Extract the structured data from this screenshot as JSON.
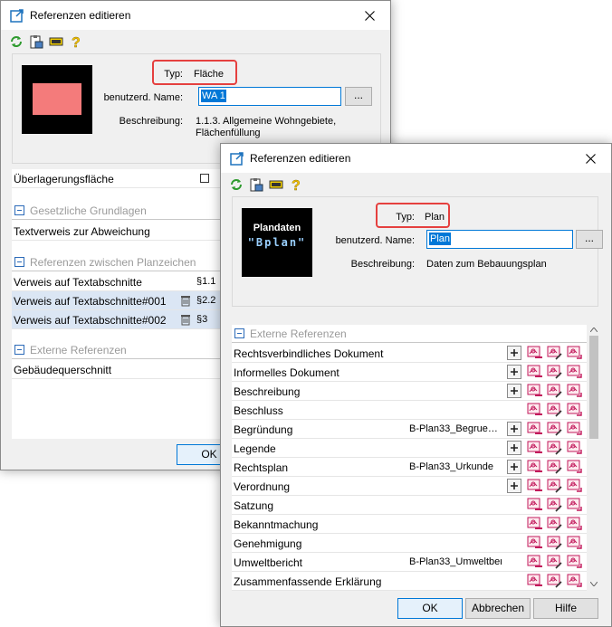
{
  "window1": {
    "title": "Referenzen editieren",
    "typ_label": "Typ:",
    "typ_value": "Fläche",
    "name_label": "benutzerd. Name:",
    "name_value": "WA 1",
    "dots_label": "...",
    "desc_label": "Beschreibung:",
    "desc_value_1": "1.1.3. Allgemeine Wohngebiete,",
    "desc_value_2": "Flächenfüllung",
    "overlay_row": "Überlagerungsfläche",
    "categories": {
      "gesetzliche": "Gesetzliche Grundlagen",
      "zwischen": "Referenzen zwischen Planzeichen",
      "externe": "Externe Referenzen"
    },
    "textverweis": "Textverweis zur Abweichung",
    "rows_zwischen": [
      {
        "name": "Verweis auf Textabschnitte",
        "value": "§1.1"
      },
      {
        "name": "Verweis auf Textabschnitte#001",
        "value": "§2.2"
      },
      {
        "name": "Verweis auf Textabschnitte#002",
        "value": "§3"
      }
    ],
    "gebaeude": "Gebäudequerschnitt",
    "ok_label": "OK"
  },
  "window2": {
    "title": "Referenzen editieren",
    "logo_line1": "Plandaten",
    "logo_line2": "\"Bplan\"",
    "typ_label": "Typ:",
    "typ_value": "Plan",
    "name_label": "benutzerd. Name:",
    "name_value": "Plan",
    "dots_label": "...",
    "desc_label": "Beschreibung:",
    "desc_value": "Daten zum Bebauungsplan",
    "category": "Externe Referenzen",
    "rows": [
      {
        "name": "Rechtsverbindliches Dokument",
        "value": "",
        "plus": true
      },
      {
        "name": "Informelles Dokument",
        "value": "",
        "plus": true
      },
      {
        "name": "Beschreibung",
        "value": "",
        "plus": true
      },
      {
        "name": "Beschluss",
        "value": "",
        "plus": false
      },
      {
        "name": "Begründung",
        "value": "B-Plan33_Begrue…",
        "plus": true
      },
      {
        "name": "Legende",
        "value": "",
        "plus": true
      },
      {
        "name": "Rechtsplan",
        "value": "B-Plan33_Urkunde",
        "plus": true
      },
      {
        "name": "Verordnung",
        "value": "",
        "plus": true
      },
      {
        "name": "Satzung",
        "value": "",
        "plus": false
      },
      {
        "name": "Bekanntmachung",
        "value": "",
        "plus": false
      },
      {
        "name": "Genehmigung",
        "value": "",
        "plus": false
      },
      {
        "name": "Umweltbericht",
        "value": "B-Plan33_Umweltberi…",
        "plus": false
      },
      {
        "name": "Zusammenfassende Erklärung",
        "value": "",
        "plus": false
      }
    ],
    "ok_label": "OK",
    "cancel_label": "Abbrechen",
    "help_label": "Hilfe"
  },
  "colors": {
    "callout": "#e5403f",
    "swatch": "#f47b7b",
    "selection": "#0078d7",
    "selected_row": "#dbe6f4"
  },
  "icons": [
    "edit-window-icon",
    "close-icon",
    "refresh-icon",
    "clipboard-icon",
    "tag-icon",
    "help-icon",
    "trash-icon",
    "plus-icon",
    "link-remove-icon",
    "link-edit-icon"
  ]
}
